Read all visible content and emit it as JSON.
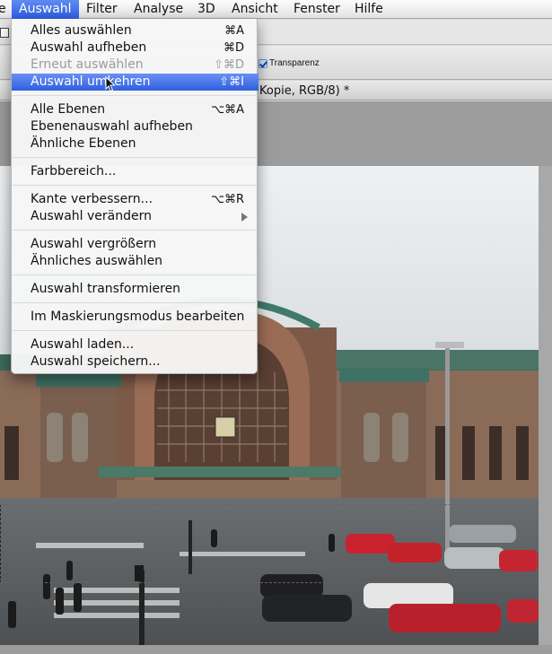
{
  "menubar": {
    "items": [
      {
        "label": "e",
        "active": false
      },
      {
        "label": "Auswahl",
        "active": true
      },
      {
        "label": "Filter",
        "active": false
      },
      {
        "label": "Analyse",
        "active": false
      },
      {
        "label": "3D",
        "active": false
      },
      {
        "label": "Ansicht",
        "active": false
      },
      {
        "label": "Fenster",
        "active": false
      },
      {
        "label": "Hilfe",
        "active": false
      }
    ]
  },
  "options": {
    "transparency_label": "Transparenz",
    "transparency_checked": true
  },
  "document": {
    "tab_title": "Kopie, RGB/8) *"
  },
  "menu": {
    "items": [
      {
        "label": "Alles auswählen",
        "shortcut": "⌘A",
        "enabled": true
      },
      {
        "label": "Auswahl aufheben",
        "shortcut": "⌘D",
        "enabled": true
      },
      {
        "label": "Erneut auswählen",
        "shortcut": "⇧⌘D",
        "enabled": false
      },
      {
        "label": "Auswahl umkehren",
        "shortcut": "⇧⌘I",
        "enabled": true,
        "highlighted": true
      },
      {
        "label": "Alle Ebenen",
        "shortcut": "⌥⌘A",
        "enabled": true
      },
      {
        "label": "Ebenenauswahl aufheben",
        "shortcut": "",
        "enabled": true
      },
      {
        "label": "Ähnliche Ebenen",
        "shortcut": "",
        "enabled": true
      },
      {
        "label": "Farbbereich...",
        "shortcut": "",
        "enabled": true
      },
      {
        "label": "Kante verbessern...",
        "shortcut": "⌥⌘R",
        "enabled": true
      },
      {
        "label": "Auswahl verändern",
        "shortcut": "",
        "enabled": true,
        "submenu": true
      },
      {
        "label": "Auswahl vergrößern",
        "shortcut": "",
        "enabled": true
      },
      {
        "label": "Ähnliches auswählen",
        "shortcut": "",
        "enabled": true
      },
      {
        "label": "Auswahl transformieren",
        "shortcut": "",
        "enabled": true
      },
      {
        "label": "Im Maskierungsmodus bearbeiten",
        "shortcut": "",
        "enabled": true
      },
      {
        "label": "Auswahl laden...",
        "shortcut": "",
        "enabled": true
      },
      {
        "label": "Auswahl speichern...",
        "shortcut": "",
        "enabled": true
      }
    ]
  },
  "colors": {
    "highlight": "#2f5fe0",
    "disabled_text": "#9b9b9b"
  }
}
